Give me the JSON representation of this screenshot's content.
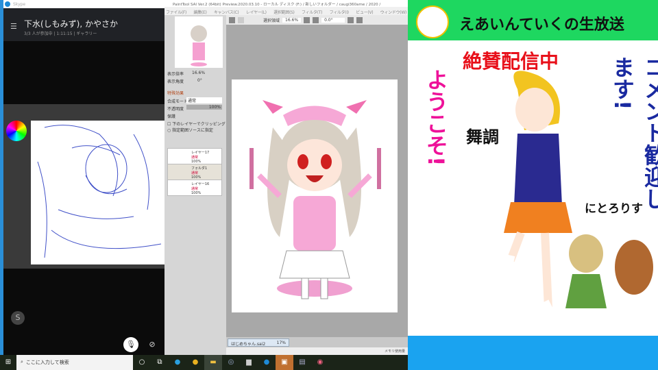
{
  "skype": {
    "app_name": "Skype",
    "chat_title": "下水(しもみず), かやさか",
    "chat_sub": "3/3 人が参加中 | 1:11:15 | ギャラリー",
    "s_icon": "S"
  },
  "sai": {
    "title": "PaintTool SAI Ver.2 (64bit) Preview.2020.03.10 - ローカル ディスク (F:) / 新しいフォルダー / caugi360ame / 2020 /",
    "menu": [
      "ファイル(F)",
      "編集(E)",
      "キャンバス(C)",
      "レイヤー(L)",
      "選択範囲(S)",
      "フィルタ(T)",
      "フィルタ(I)",
      "ビュー(V)",
      "ウィンドウ(W)"
    ],
    "toolbar": {
      "selection": "選択領域",
      "zoom": "16.6%",
      "angle": "0.0°"
    },
    "nav": {
      "zoom_label": "表示倍率",
      "zoom": "16.6%",
      "angle_label": "表示角度",
      "angle": "0°"
    },
    "layer_props": {
      "section": "特殊効果",
      "blend_label": "合成モード",
      "blend": "通常",
      "opacity_label": "不透明度",
      "opacity": "100%",
      "protect_label": "保護",
      "clip": "下のレイヤーでクリッピング",
      "sel_src": "指定範囲ソースに指定"
    },
    "layers": [
      {
        "name": "レイヤー17",
        "mode": "通常",
        "opacity": "100%"
      },
      {
        "name": "フォルダ1",
        "mode": "通常",
        "opacity": "100%"
      },
      {
        "name": "レイヤー16",
        "mode": "通常",
        "opacity": "100%"
      }
    ],
    "doc_tab": {
      "name": "はじめちゃん.sai2",
      "zoom": "17%"
    },
    "status": "メモリ使用量"
  },
  "overlay": {
    "title": "えあいんていくの生放送",
    "live": "絶賛配信中",
    "welcome": "ようこそ!",
    "comment": "コメント歓迎します!",
    "butou": "舞調",
    "nitori": "にとろりす"
  },
  "taskbar": {
    "search_placeholder": "ここに入力して検索"
  },
  "colors": {
    "green": "#1ed760",
    "blue": "#1aa3f0",
    "red": "#e8101a",
    "magenta": "#ee1199",
    "navy": "#1a2aa0"
  }
}
